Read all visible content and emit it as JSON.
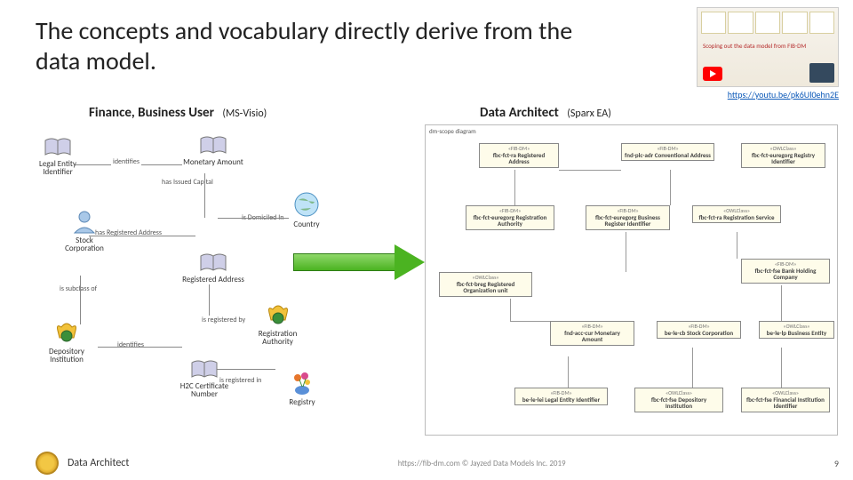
{
  "title": "The concepts and vocabulary directly derive from the data model.",
  "video": {
    "caption": "Scoping out the data model from FIB-DM",
    "link_text": "https://youtu.be/pk6Ul0ehn2E",
    "link_href": "https://youtu.be/pk6Ul0ehn2E"
  },
  "subheadings": {
    "fbu": {
      "label": "Finance, Business User",
      "tool": "(MS-Visio)"
    },
    "da": {
      "label": "Data Architect",
      "tool": "(Sparx EA)"
    }
  },
  "visio": {
    "nodes": {
      "lei": "Legal Entity Identifier",
      "monetary": "Monetary Amount",
      "country": "Country",
      "stock": "Stock Corporation",
      "regaddr": "Registered Address",
      "depinst": "Depository Institution",
      "regauth": "Registration Authority",
      "hccert": "H2C Certificate Number",
      "registry": "Registry"
    },
    "edges": {
      "identifies1": "identifies",
      "hasIssuedCapital": "has Issued Capital",
      "isDomiciledIn": "is Domiciled In",
      "hasRegisteredAddress": "has Registered Address",
      "isSubclassOf": "is subclass of",
      "identifies2": "identifies",
      "isRegisteredBy": "is registered by",
      "isRegisteredIn": "is registered in"
    }
  },
  "ea": {
    "title": "dm-scope diagram",
    "boxes": {
      "b1": {
        "ster": "«FIB-DM»",
        "cls": "fbc-fct-ra Registered Address"
      },
      "b2": {
        "ster": "«FIB-DM»",
        "cls": "fnd-plc-adr Conventional Address"
      },
      "b3": {
        "ster": "«OWLClass»",
        "cls": "fbc-fct-euregorg Registry Identifier"
      },
      "b4": {
        "ster": "«FIB-DM»",
        "cls": "fbc-fct-euregorg Registration Authority"
      },
      "b5": {
        "ster": "«FIB-DM»",
        "cls": "fbc-fct-euregorg Business Register Identifier"
      },
      "b6": {
        "ster": "«OWLClass»",
        "cls": "fbc-fct-ra Registration Service"
      },
      "b7": {
        "ster": "«OWLClass»",
        "cls": "fbc-fct-breg Registered Organization unit"
      },
      "b8": {
        "ster": "«FIB-DM»",
        "cls": "fbc-fct-fse Bank Holding Company"
      },
      "b9": {
        "ster": "«FIB-DM»",
        "cls": "fnd-acc-cur Monetary Amount"
      },
      "b10": {
        "ster": "«FIB-DM»",
        "cls": "be-le-cb Stock Corporation"
      },
      "b11": {
        "ster": "«OWLClass»",
        "cls": "be-le-lp Business Entity"
      },
      "b12": {
        "ster": "«FIB-DM»",
        "cls": "be-le-lei Legal Entity Identifier"
      },
      "b13": {
        "ster": "«OWLClass»",
        "cls": "fbc-fct-fse Depository Institution"
      },
      "b14": {
        "ster": "«OWLClass»",
        "cls": "fbc-fct-fse Financial Institution Identifier"
      }
    }
  },
  "footer": {
    "role": "Data Architect",
    "credit": "https://fib-dm.com © Jayzed Data Models Inc. 2019",
    "page": "9"
  }
}
